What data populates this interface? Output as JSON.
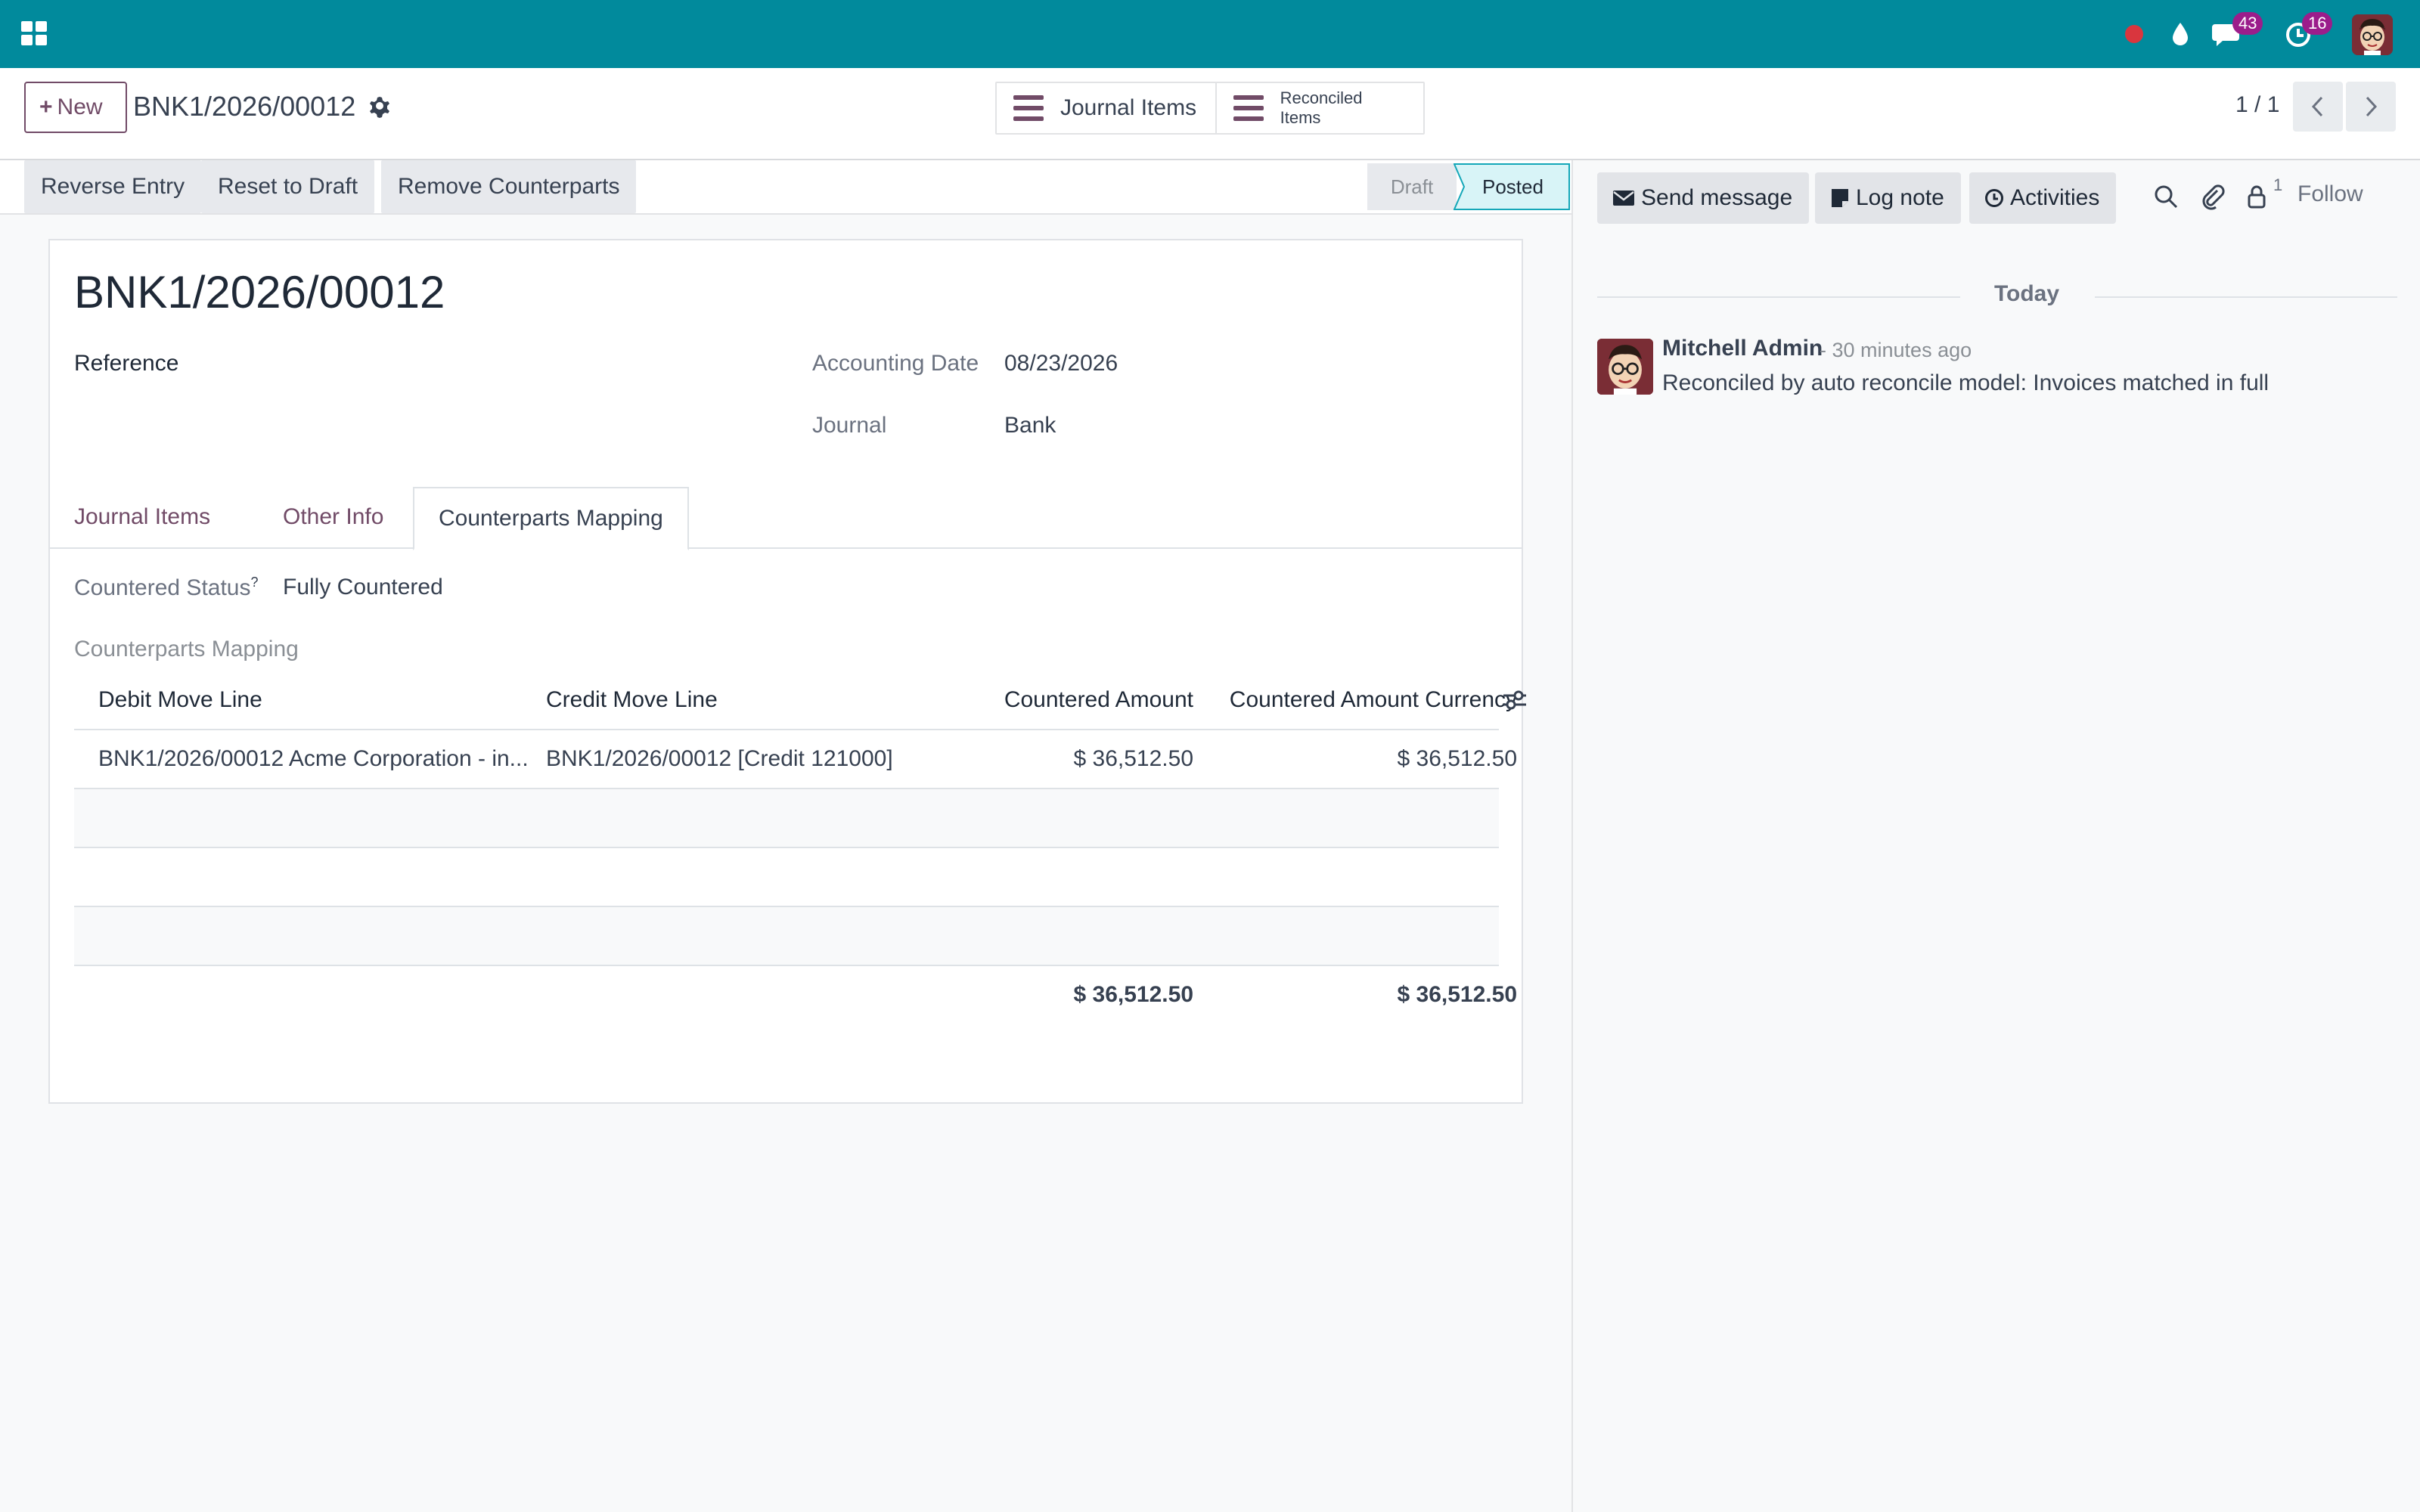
{
  "navbar": {
    "messages_count": "43",
    "activities_count": "16"
  },
  "control_panel": {
    "new_label": "New",
    "breadcrumb": "BNK1/2026/00012",
    "smart_buttons": [
      "Journal Items",
      "Reconciled Items"
    ],
    "pager": "1 / 1"
  },
  "actions": {
    "reverse_entry": "Reverse Entry",
    "reset_to_draft": "Reset to Draft",
    "remove_counterparts": "Remove Counterparts"
  },
  "status": {
    "draft": "Draft",
    "posted": "Posted",
    "active": "Posted",
    "active_color": "#d8f4f7"
  },
  "form": {
    "title": "BNK1/2026/00012",
    "reference_label": "Reference",
    "accounting_date_label": "Accounting Date",
    "accounting_date": "08/23/2026",
    "journal_label": "Journal",
    "journal": "Bank",
    "tabs": [
      "Journal Items",
      "Other Info",
      "Counterparts Mapping"
    ],
    "active_tab": "Counterparts Mapping",
    "countered_status_label": "Countered Status",
    "countered_status_tip": "?",
    "countered_status": "Fully Countered",
    "mapping_label": "Counterparts Mapping",
    "table": {
      "columns": [
        "Debit Move Line",
        "Credit Move Line",
        "Countered Amount",
        "Countered Amount Currency"
      ],
      "rows": [
        {
          "debit": "BNK1/2026/00012 Acme Corporation - in...",
          "credit": "BNK1/2026/00012 [Credit 121000]",
          "amount": "$ 36,512.50",
          "amount_currency": "$ 36,512.50"
        }
      ],
      "totals": {
        "amount": "$ 36,512.50",
        "amount_currency": "$ 36,512.50"
      }
    }
  },
  "chatter": {
    "send_message": "Send message",
    "log_note": "Log note",
    "activities": "Activities",
    "followers_count": "1",
    "follow": "Follow",
    "date_separator": "Today",
    "messages": [
      {
        "author": "Mitchell Admin",
        "time": "- 30 minutes ago",
        "body": "Reconciled by auto reconcile model: Invoices matched in full"
      }
    ]
  },
  "colors": {
    "navbar": "#018a9c",
    "primary": "#714b67",
    "badge": "#9b1d8b"
  }
}
